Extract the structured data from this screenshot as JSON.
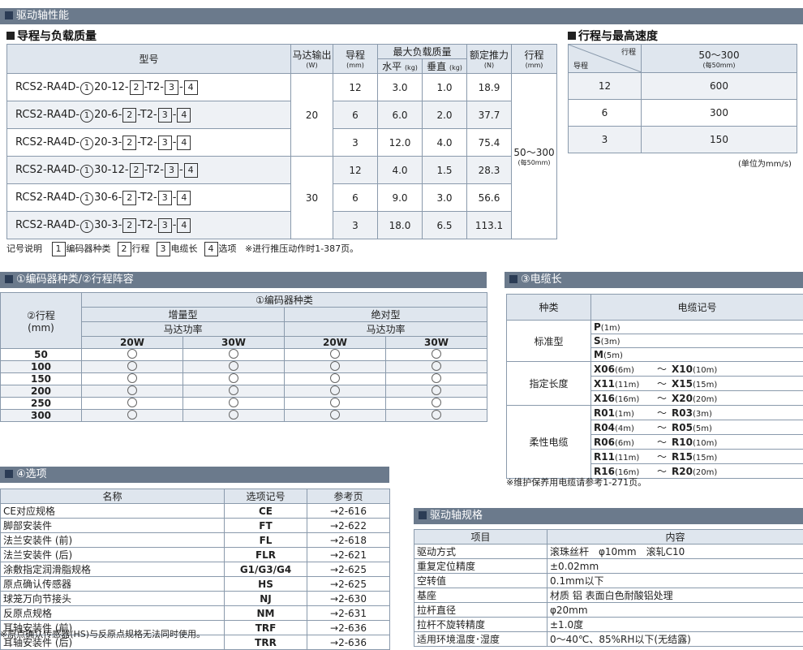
{
  "section_drive": "驱动轴性能",
  "lead_load": {
    "title": "导程与负载质量",
    "headers": {
      "model": "型号",
      "motor": "马达输出",
      "motor_unit": "(W)",
      "lead": "导程",
      "lead_unit": "(mm)",
      "maxload": "最大负载质量",
      "horizontal": "水平",
      "horizontal_unit": "(kg)",
      "vertical": "垂直",
      "vertical_unit": "(kg)",
      "thrust": "额定推力",
      "thrust_unit": "(N)",
      "stroke": "行程",
      "stroke_unit": "(mm)"
    },
    "model_prefix": "RCS2-RA4D-",
    "symbols": {
      "c1": "1",
      "c2": "2",
      "c3": "3",
      "c4": "4",
      "t2": "-T2-"
    },
    "rows": [
      {
        "motor_lead": "20-12",
        "lead": "12",
        "h": "3.0",
        "v": "1.0",
        "thrust": "18.9"
      },
      {
        "motor_lead": "20-6",
        "lead": "6",
        "h": "6.0",
        "v": "2.0",
        "thrust": "37.7"
      },
      {
        "motor_lead": "20-3",
        "lead": "3",
        "h": "12.0",
        "v": "4.0",
        "thrust": "75.4"
      },
      {
        "motor_lead": "30-12",
        "lead": "12",
        "h": "4.0",
        "v": "1.5",
        "thrust": "28.3"
      },
      {
        "motor_lead": "30-6",
        "lead": "6",
        "h": "9.0",
        "v": "3.0",
        "thrust": "56.6"
      },
      {
        "motor_lead": "30-3",
        "lead": "3",
        "h": "18.0",
        "v": "6.5",
        "thrust": "113.1"
      }
    ],
    "motor_20": "20",
    "motor_30": "30",
    "stroke_value": "50～300",
    "stroke_note": "(每50mm)",
    "legend_prefix": "记号说明",
    "legend_1": "编码器种类",
    "legend_2": "行程",
    "legend_3": "电缆长",
    "legend_4": "选项",
    "legend_note": "※进行推压动作时1-387页。"
  },
  "speed": {
    "title": "行程与最高速度",
    "diag_top": "行程",
    "diag_bottom": "导程",
    "stroke": "50～300",
    "stroke_note": "(每50mm)",
    "rows": [
      {
        "lead": "12",
        "speed": "600"
      },
      {
        "lead": "6",
        "speed": "300"
      },
      {
        "lead": "3",
        "speed": "150"
      }
    ],
    "unit_note": "(单位为mm/s)"
  },
  "encoder": {
    "bar": "①编码器种类/②行程阵容",
    "stroke_header": "②行程",
    "stroke_unit": "(mm)",
    "encoder_header": "①编码器种类",
    "incremental": "增量型",
    "absolute": "绝对型",
    "motor_power": "马达功率",
    "w20": "20W",
    "w30": "30W",
    "strokes": [
      "50",
      "100",
      "150",
      "200",
      "250",
      "300"
    ]
  },
  "cable": {
    "bar": "③电缆长",
    "h_kind": "种类",
    "h_code": "电缆记号",
    "standard": "标准型",
    "specified": "指定长度",
    "robot": "柔性电缆",
    "std_rows": [
      {
        "code": "P",
        "len": "(1m)"
      },
      {
        "code": "S",
        "len": "(3m)"
      },
      {
        "code": "M",
        "len": "(5m)"
      }
    ],
    "spec_rows": [
      {
        "a": "X06",
        "al": "(6m)",
        "b": "X10",
        "bl": "(10m)"
      },
      {
        "a": "X11",
        "al": "(11m)",
        "b": "X15",
        "bl": "(15m)"
      },
      {
        "a": "X16",
        "al": "(16m)",
        "b": "X20",
        "bl": "(20m)"
      }
    ],
    "robot_rows": [
      {
        "a": "R01",
        "al": "(1m)",
        "b": "R03",
        "bl": "(3m)"
      },
      {
        "a": "R04",
        "al": "(4m)",
        "b": "R05",
        "bl": "(5m)"
      },
      {
        "a": "R06",
        "al": "(6m)",
        "b": "R10",
        "bl": "(10m)"
      },
      {
        "a": "R11",
        "al": "(11m)",
        "b": "R15",
        "bl": "(15m)"
      },
      {
        "a": "R16",
        "al": "(16m)",
        "b": "R20",
        "bl": "(20m)"
      }
    ],
    "tilde": "～",
    "note": "※维护保养用电缆请参考1-271页。"
  },
  "options": {
    "bar": "④选项",
    "h_name": "名称",
    "h_code": "选项记号",
    "h_page": "参考页",
    "rows": [
      {
        "name": "CE对应规格",
        "code": "CE",
        "page": "→2-616"
      },
      {
        "name": "脚部安装件",
        "code": "FT",
        "page": "→2-622"
      },
      {
        "name": "法兰安装件 (前)",
        "code": "FL",
        "page": "→2-618"
      },
      {
        "name": "法兰安装件 (后)",
        "code": "FLR",
        "page": "→2-621"
      },
      {
        "name": "涂敷指定润滑脂规格",
        "code": "G1/G3/G4",
        "page": "→2-625"
      },
      {
        "name": "原点确认传感器",
        "code": "HS",
        "page": "→2-625"
      },
      {
        "name": "球笼万向节接头",
        "code": "NJ",
        "page": "→2-630"
      },
      {
        "name": "反原点规格",
        "code": "NM",
        "page": "→2-631"
      },
      {
        "name": "耳轴安装件 (前)",
        "code": "TRF",
        "page": "→2-636"
      },
      {
        "name": "耳轴安装件 (后)",
        "code": "TRR",
        "page": "→2-636"
      }
    ],
    "note": "※原点确认传感器(HS)与反原点规格无法同时使用。"
  },
  "spec": {
    "bar": "驱动轴规格",
    "h_item": "项目",
    "h_content": "内容",
    "rows": [
      {
        "item": "驱动方式",
        "content": "滚珠丝杆　φ10mm　滚轧C10"
      },
      {
        "item": "重复定位精度",
        "content": "±0.02mm"
      },
      {
        "item": "空转值",
        "content": "0.1mm以下"
      },
      {
        "item": "基座",
        "content": "材质 铝 表面白色耐酸铝处理"
      },
      {
        "item": "拉杆直径",
        "content": "φ20mm"
      },
      {
        "item": "拉杆不旋转精度",
        "content": "±1.0度"
      },
      {
        "item": "适用环境温度･湿度",
        "content": "0～40℃、85%RH以下(无结露)"
      }
    ]
  }
}
